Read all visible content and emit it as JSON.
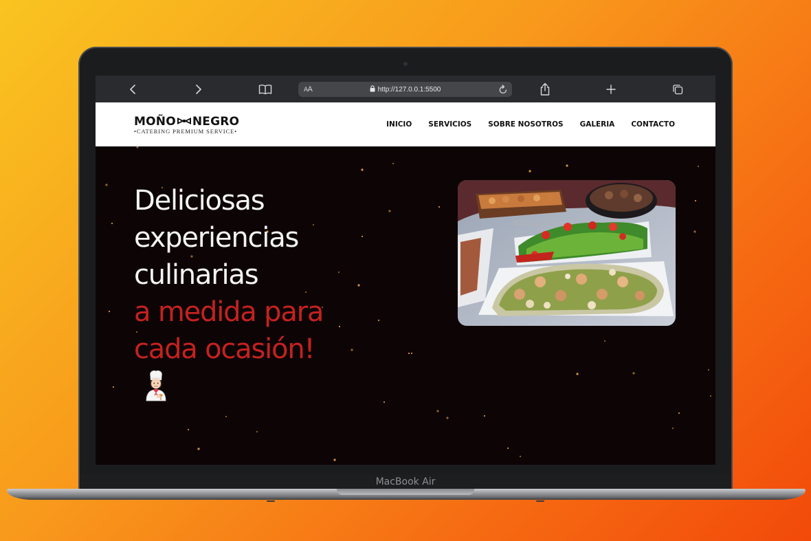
{
  "device": {
    "model_label": "MacBook Air"
  },
  "browser": {
    "text_size_label": "AA",
    "url": "http://127.0.0.1:5500",
    "icons": [
      "back-icon",
      "forward-icon",
      "bookmarks-icon",
      "lock-icon",
      "reload-icon",
      "share-icon",
      "new-tab-icon",
      "tabs-icon"
    ]
  },
  "site": {
    "logo": {
      "name": "MOÑO NEGRO",
      "left_word": "MOÑO",
      "right_word": "NEGRO",
      "tagline": "•CATERING PREMIUM SERVICE•"
    },
    "nav": [
      "INICIO",
      "SERVICIOS",
      "SOBRE NOSOTROS",
      "GALERIA",
      "CONTACTO"
    ]
  },
  "hero": {
    "headline_white": [
      "Deliciosas",
      "experiencias",
      "culinarias"
    ],
    "headline_red": [
      "a medida para",
      "cada ocasión!"
    ],
    "emoji": "chef-emoji",
    "image": "catering-food-platters",
    "colors": {
      "background": "#0d0406",
      "accent_red": "#c5221f",
      "star": "#e8a54a"
    }
  }
}
